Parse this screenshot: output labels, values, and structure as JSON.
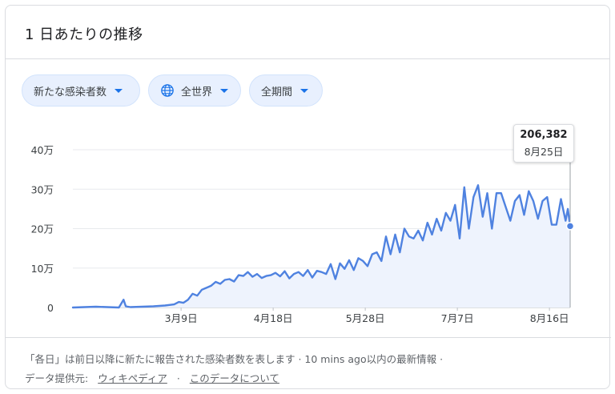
{
  "card": {
    "title": "1 日あたりの推移"
  },
  "chips": [
    {
      "label": "新たな感染者数"
    },
    {
      "label": "全世界",
      "icon": "globe-icon"
    },
    {
      "label": "全期間"
    }
  ],
  "tooltip": {
    "value": "206,382",
    "date": "8月25日"
  },
  "footer": {
    "note": "「各日」は前日以降に新たに報告された感染者数を表します · 10 mins ago以内の最新情報 ·",
    "source_label": "データ提供元:",
    "source_link": "ウィキペディア",
    "separator": "·",
    "about_link": "このデータについて"
  },
  "colors": {
    "line": "#4f82e0",
    "fill": "#eef3fd",
    "chip_bg": "#e8f0fe",
    "accent": "#1a73e8"
  },
  "chart_data": {
    "type": "area",
    "x_unit": "days since 2020-01-22",
    "x_ticks": [
      {
        "x": 47,
        "label": "3月9日"
      },
      {
        "x": 87,
        "label": "4月18日"
      },
      {
        "x": 127,
        "label": "5月28日"
      },
      {
        "x": 167,
        "label": "7月7日"
      },
      {
        "x": 207,
        "label": "8月16日"
      }
    ],
    "y_ticks": [
      {
        "y": 0,
        "label": "0"
      },
      {
        "y": 100000,
        "label": "10万"
      },
      {
        "y": 200000,
        "label": "20万"
      },
      {
        "y": 300000,
        "label": "30万"
      },
      {
        "y": 400000,
        "label": "40万"
      }
    ],
    "ylim": [
      0,
      400000
    ],
    "xlim": [
      0,
      216
    ],
    "x": [
      0,
      5,
      10,
      15,
      20,
      22,
      23,
      25,
      30,
      35,
      40,
      44,
      46,
      48,
      50,
      52,
      54,
      56,
      58,
      60,
      62,
      64,
      66,
      68,
      70,
      72,
      74,
      76,
      78,
      80,
      82,
      84,
      86,
      88,
      90,
      92,
      94,
      96,
      98,
      100,
      102,
      104,
      106,
      108,
      110,
      112,
      114,
      116,
      118,
      120,
      122,
      124,
      126,
      128,
      130,
      132,
      134,
      136,
      138,
      140,
      142,
      144,
      146,
      148,
      150,
      152,
      154,
      156,
      158,
      160,
      162,
      164,
      166,
      168,
      170,
      172,
      174,
      176,
      178,
      180,
      182,
      184,
      186,
      188,
      190,
      192,
      194,
      196,
      198,
      200,
      202,
      204,
      206,
      208,
      210,
      212,
      214,
      215,
      216
    ],
    "values": [
      0,
      1000,
      2000,
      1000,
      0,
      20000,
      3000,
      1000,
      2000,
      3000,
      5000,
      8000,
      14000,
      12000,
      20000,
      35000,
      30000,
      45000,
      50000,
      55000,
      65000,
      60000,
      70000,
      72000,
      66000,
      82000,
      80000,
      90000,
      78000,
      85000,
      75000,
      80000,
      82000,
      88000,
      79000,
      92000,
      74000,
      85000,
      90000,
      80000,
      95000,
      76000,
      93000,
      90000,
      85000,
      110000,
      72000,
      112000,
      98000,
      120000,
      95000,
      125000,
      118000,
      105000,
      135000,
      140000,
      118000,
      180000,
      135000,
      185000,
      140000,
      200000,
      180000,
      175000,
      195000,
      170000,
      215000,
      185000,
      225000,
      195000,
      240000,
      220000,
      260000,
      175000,
      305000,
      200000,
      280000,
      310000,
      230000,
      290000,
      200000,
      290000,
      290000,
      255000,
      220000,
      270000,
      285000,
      235000,
      295000,
      270000,
      225000,
      270000,
      280000,
      210000,
      210000,
      275000,
      220000,
      250000,
      206382
    ],
    "highlight": {
      "x": 216,
      "y": 206382
    }
  }
}
